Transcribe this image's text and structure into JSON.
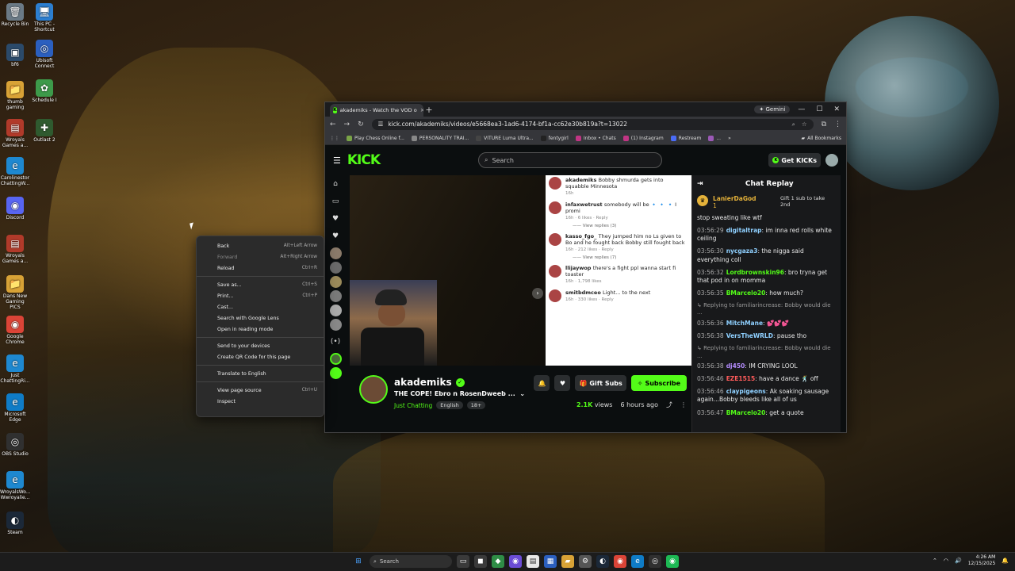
{
  "desktop": {
    "icons": [
      {
        "label": "Recycle Bin",
        "glyph": "🗑",
        "color": "#6b7a86"
      },
      {
        "label": "This PC - Shortcut",
        "glyph": "🖥",
        "color": "#2c7fd1"
      },
      {
        "label": "bf6",
        "glyph": "▣",
        "color": "#2b4a6a"
      },
      {
        "label": "Ubisoft Connect",
        "glyph": "◎",
        "color": "#2b5fbf"
      },
      {
        "label": "thumb gaming",
        "glyph": "📁",
        "color": "#d8a236"
      },
      {
        "label": "Schedule I",
        "glyph": "✿",
        "color": "#3d9a4a"
      },
      {
        "label": "Wroyals Games a...",
        "glyph": "▤",
        "color": "#b13a2a"
      },
      {
        "label": "Outlast 2",
        "glyph": "✚",
        "color": "#2f5a2f"
      },
      {
        "label": "Carolinestor ChattingW...",
        "glyph": "e",
        "color": "#1e88d0"
      },
      {
        "label": "Discord",
        "glyph": "◉",
        "color": "#5865f2"
      },
      {
        "label": "Wroyals Games a...",
        "glyph": "▤",
        "color": "#b13a2a"
      },
      {
        "label": "Dans New Gaming PICS",
        "glyph": "📁",
        "color": "#d8a236"
      },
      {
        "label": "Google Chrome",
        "glyph": "◉",
        "color": "#db4437"
      },
      {
        "label": "Just ChattingRi...",
        "glyph": "e",
        "color": "#1e88d0"
      },
      {
        "label": "Microsoft Edge",
        "glyph": "e",
        "color": "#0f7cc7"
      },
      {
        "label": "OBS Studio",
        "glyph": "◎",
        "color": "#303030"
      },
      {
        "label": "WroyalsWo... Wwroyalie...",
        "glyph": "e",
        "color": "#1e88d0"
      },
      {
        "label": "Steam",
        "glyph": "◐",
        "color": "#1b2838"
      }
    ]
  },
  "browser": {
    "tab_title": "akademiks - Watch the VOD o",
    "tab_fav": "K",
    "tab_close": "×",
    "new_tab": "+",
    "gemini": "✦ Gemini",
    "min": "—",
    "max": "☐",
    "close": "✕",
    "back": "←",
    "forward": "→",
    "reload": "↻",
    "url": "kick.com/akademiks/videos/e5668ea3-1ad6-4174-bf1a-cc62e30b819a?t=13022",
    "bookmarks": [
      {
        "label": "Play Chess Online f...",
        "color": "#7aa447"
      },
      {
        "label": "PERSONALITY TRAI...",
        "color": "#888888"
      },
      {
        "label": "VITURE Luma Ultra...",
        "color": "#444444"
      },
      {
        "label": "fentygirl",
        "color": "#222222"
      },
      {
        "label": "Inbox • Chats",
        "color": "#c13584"
      },
      {
        "label": "(1) Instagram",
        "color": "#c13584"
      },
      {
        "label": "Restream",
        "color": "#4a6cf7"
      },
      {
        "label": "...",
        "color": "#9b59b6"
      }
    ],
    "all_bookmarks": "All Bookmarks"
  },
  "kick": {
    "logo": "KICK",
    "search_placeholder": "Search",
    "get_kicks": "Get KICKs",
    "sidebar_icons": [
      "⌂",
      "▭",
      "♥"
    ],
    "streamer": "akademiks",
    "stream_title": "THE COPE! Ebro n RosenDweeb ...",
    "category": "Just Chatting",
    "tags": [
      "English",
      "18+"
    ],
    "gift_subs": "Gift Subs",
    "subscribe": "Subscribe",
    "views": "2.1K",
    "views_label": "views",
    "ago": "6 hours ago"
  },
  "video_chat": {
    "comments": [
      {
        "user": "akademiks",
        "text": "Bobby shmurda gets into squabble Minnesota",
        "meta": "16h",
        "replies": ""
      },
      {
        "user": "infaxwetrust",
        "text": "somebody will be 🔹 🔹 🔹 I promi",
        "meta": "16h · 6 likes · Reply",
        "replies": "View replies (3)"
      },
      {
        "user": "kasso_fgo_",
        "text": "They jumped him no Ls given to Bo and he fought back Bobby still fought back",
        "meta": "16h · 212 likes · Reply",
        "replies": "View replies (7)"
      },
      {
        "user": "llijaywop",
        "text": "there's a fight ppl wanna start fi toaster",
        "meta": "16h · 1,798 likes",
        "replies": ""
      },
      {
        "user": "smitbdmceo",
        "text": "Light... to the next",
        "meta": "16h · 330 likes · Reply",
        "replies": ""
      }
    ]
  },
  "chat": {
    "title": "Chat Replay",
    "gifter": {
      "name": "LanierDaGod",
      "count": "1",
      "gift_text": "Gift 1 sub to take 2nd"
    },
    "messages": [
      {
        "time": "",
        "user": "",
        "color": "#ffffff",
        "text": "stop sweating like wtf",
        "reply": ""
      },
      {
        "time": "03:56:29",
        "user": "digitaltrap",
        "color": "#8fd0ff",
        "text": ": im inna red rolls white ceiling",
        "reply": ""
      },
      {
        "time": "03:56:30",
        "user": "nycgaza3",
        "color": "#8fd0ff",
        "text": ": the nigga said everything coll",
        "reply": ""
      },
      {
        "time": "03:56:32",
        "user": "Lordbrownskin96",
        "color": "#53fc18",
        "text": ": bro tryna get that pod in on momma",
        "reply": ""
      },
      {
        "time": "03:56:35",
        "user": "BMarcelo20",
        "color": "#53fc18",
        "text": ": how much?",
        "reply": ""
      },
      {
        "time": "03:56:36",
        "user": "MitchMane",
        "color": "#8fd0ff",
        "text": ": 💕💕💕",
        "reply": "↳ Replying to familiarincrease: Bobby would die ..."
      },
      {
        "time": "03:56:38",
        "user": "VersTheWRLD",
        "color": "#8fd0ff",
        "text": ": pause tho",
        "reply": ""
      },
      {
        "time": "03:56:38",
        "user": "dj450",
        "color": "#b48cff",
        "text": ": IM CRYING LOOL",
        "reply": "↳ Replying to familiarincrease: Bobby would die ..."
      },
      {
        "time": "03:56:46",
        "user": "EZE1515",
        "color": "#ff5b5b",
        "text": ": have a dance 🕺 off",
        "reply": ""
      },
      {
        "time": "03:56:46",
        "user": "claypigeons",
        "color": "#8fd0ff",
        "text": ": Ak soaking sausage again...Bobby bleeds like all of us",
        "reply": ""
      },
      {
        "time": "03:56:47",
        "user": "BMarcelo20",
        "color": "#53fc18",
        "text": ": get a quote",
        "reply": ""
      }
    ]
  },
  "context_menu": {
    "items": [
      {
        "label": "Back",
        "shortcut": "Alt+Left Arrow",
        "disabled": false
      },
      {
        "label": "Forward",
        "shortcut": "Alt+Right Arrow",
        "disabled": true
      },
      {
        "label": "Reload",
        "shortcut": "Ctrl+R",
        "disabled": false
      },
      {
        "sep": true
      },
      {
        "label": "Save as...",
        "shortcut": "Ctrl+S",
        "disabled": false
      },
      {
        "label": "Print...",
        "shortcut": "Ctrl+P",
        "disabled": false
      },
      {
        "label": "Cast...",
        "shortcut": "",
        "disabled": false
      },
      {
        "label": "Search with Google Lens",
        "shortcut": "",
        "disabled": false
      },
      {
        "label": "Open in reading mode",
        "shortcut": "",
        "disabled": false
      },
      {
        "sep": true
      },
      {
        "label": "Send to your devices",
        "shortcut": "",
        "disabled": false
      },
      {
        "label": "Create QR Code for this page",
        "shortcut": "",
        "disabled": false
      },
      {
        "sep": true
      },
      {
        "label": "Translate to English",
        "shortcut": "",
        "disabled": false
      },
      {
        "sep": true
      },
      {
        "label": "View page source",
        "shortcut": "Ctrl+U",
        "disabled": false
      },
      {
        "label": "Inspect",
        "shortcut": "",
        "disabled": false
      }
    ]
  },
  "taskbar": {
    "search_placeholder": "Search",
    "time": "4:26 AM",
    "date": "12/15/2025",
    "apps": [
      {
        "glyph": "▭",
        "color": "#3a3a3a"
      },
      {
        "glyph": "◼",
        "color": "#3a3a3a"
      },
      {
        "glyph": "◆",
        "color": "#2f8d46"
      },
      {
        "glyph": "◉",
        "color": "#6b4cd6"
      },
      {
        "glyph": "▤",
        "color": "#e8e8e8"
      },
      {
        "glyph": "▦",
        "color": "#2b5fbf"
      },
      {
        "glyph": "▰",
        "color": "#d8a236"
      },
      {
        "glyph": "⚙",
        "color": "#555555"
      },
      {
        "glyph": "◐",
        "color": "#1b2838"
      },
      {
        "glyph": "◉",
        "color": "#db4437"
      },
      {
        "glyph": "e",
        "color": "#0f7cc7"
      },
      {
        "glyph": "◎",
        "color": "#303030"
      },
      {
        "glyph": "◉",
        "color": "#1db954"
      }
    ]
  }
}
